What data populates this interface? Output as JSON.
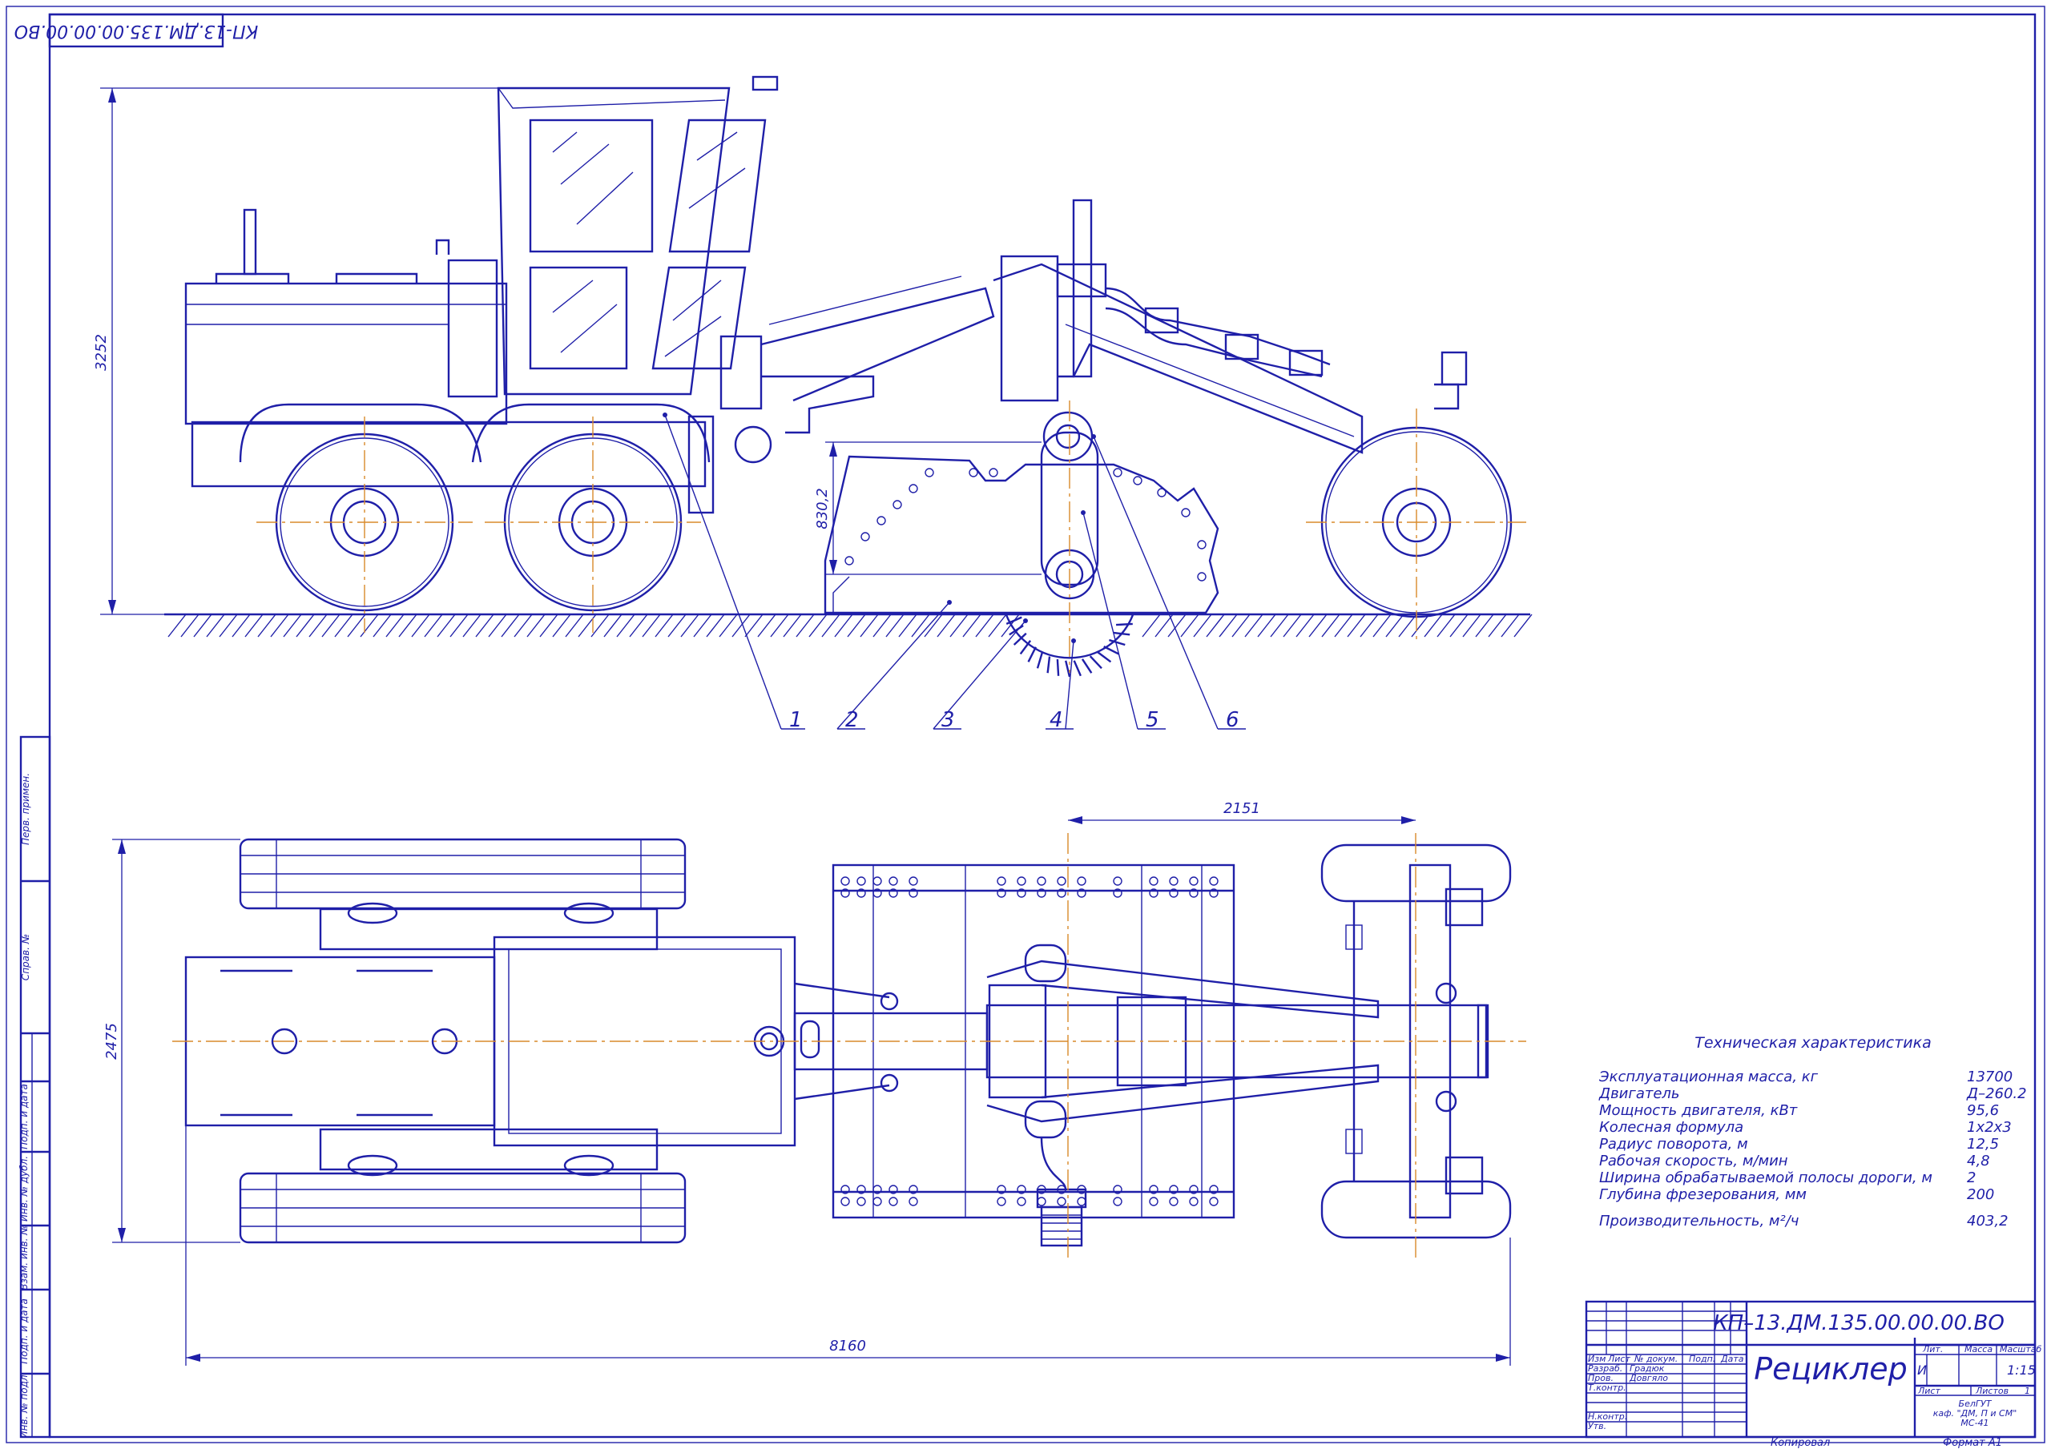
{
  "drawing": {
    "code_stamp": "КП-13.ДМ.135.00.00.00.ВО",
    "code_title": "КП–13.ДМ.135.00.00.00.ВО",
    "title": "Рециклер"
  },
  "dimensions": {
    "height": "3252",
    "depth": "830,2",
    "span": "2151",
    "width": "2475",
    "length": "8160"
  },
  "positions": [
    "1",
    "2",
    "3",
    "4",
    "5",
    "6"
  ],
  "specs": {
    "title": "Техническая характеристика",
    "rows": [
      {
        "label": "Эксплуатационная масса, кг",
        "value": "13700"
      },
      {
        "label": "Двигатель",
        "value": "Д–260.2"
      },
      {
        "label": "Мощность двигателя, кВт",
        "value": "95,6"
      },
      {
        "label": "Колесная формула",
        "value": "1х2х3"
      },
      {
        "label": "Радиус поворота, м",
        "value": "12,5"
      },
      {
        "label": "Рабочая скорость, м/мин",
        "value": "4,8"
      },
      {
        "label": "Ширина обрабатываемой полосы дороги, м",
        "value": "2"
      },
      {
        "label": "Глубина фрезерования, мм",
        "value": "200"
      },
      {
        "label": "Производительность, м²/ч",
        "value": "403,2"
      }
    ]
  },
  "side_stamps": [
    "Перв. примен.",
    "Справ. №",
    "Подп. и дата",
    "Инв. № дубл.",
    "Взам. инв. №",
    "Подп. и дата",
    "Инв. № подл."
  ],
  "title_block": {
    "col_headers": [
      "Изм",
      "Лист",
      "№ докум.",
      "Подп.",
      "Дата"
    ],
    "roles": [
      "Разраб.",
      "Пров.",
      "Т.контр.",
      "Н.контр.",
      "Утв."
    ],
    "names": [
      "Градюк",
      "Довгяло"
    ],
    "lit_header": "Лит.",
    "mass_header": "Масса",
    "scale_header": "Масштаб",
    "lit_value": "И",
    "scale_value": "1:15",
    "sheet_label": "Лист",
    "sheets_label": "Листов",
    "sheets_value": "1",
    "org_line1": "БелГУТ",
    "org_line2": "каф. \"ДМ, П и СМ\"",
    "org_line3": "МС-41",
    "copied": "Копировал",
    "format": "Формат   А1"
  }
}
